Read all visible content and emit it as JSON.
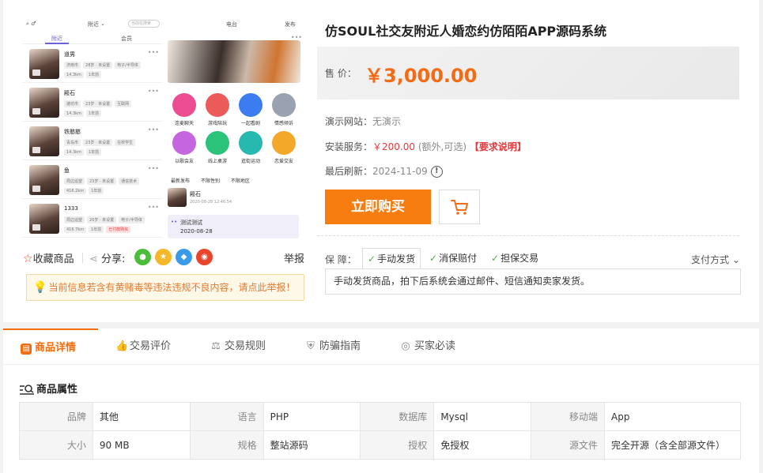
{
  "gallery": {
    "topbar": {
      "nearby_dropdown": "附近",
      "search_placeholder": "当前在搜索",
      "center": "电台",
      "publish": "发布"
    },
    "tabs": [
      "附近",
      "会员"
    ],
    "users": [
      {
        "name": "道男",
        "tags": [
          "济南市",
          "28岁 · 未设置",
          "电子/半导体"
        ],
        "meta": [
          "14.3km",
          "1年前"
        ]
      },
      {
        "name": "殿石",
        "tags": [
          "潍坊市",
          "23岁 · 未设置",
          "互联网"
        ],
        "meta": [
          "14.3km",
          "1年前"
        ]
      },
      {
        "name": "铁憨憨",
        "tags": [
          "青岛市",
          "23岁 · 未设置",
          "在校学生"
        ],
        "meta": [
          "14.3km",
          "1年前"
        ]
      },
      {
        "name": "鱼",
        "tags": [
          "周边遥望",
          "23岁 · 未设置",
          "通信技术"
        ],
        "meta": [
          "416.2km",
          "1年前"
        ]
      },
      {
        "name": "1333",
        "tags": [
          "周边遥望",
          "20岁 · 未设置",
          "电子/半导体"
        ],
        "meta": [
          "416.7km",
          "1年前",
          "已付款购买"
        ]
      }
    ],
    "icons": [
      {
        "label": "连麦聊天",
        "color": "#ec4c90"
      },
      {
        "label": "游戏陪玩",
        "color": "#ec5a5a"
      },
      {
        "label": "一起看剧",
        "color": "#3c7cf0"
      },
      {
        "label": "情感倾诉",
        "color": "#9aa1b0"
      },
      {
        "label": "以歌会友",
        "color": "#c565e0"
      },
      {
        "label": "线上桌游",
        "color": "#2bc27a"
      },
      {
        "label": "逛街运动",
        "color": "#27b8b0"
      },
      {
        "label": "恋爱交友",
        "color": "#f3a82a"
      }
    ],
    "filters": [
      "最新发布",
      "不限性别",
      "不限地区"
    ],
    "post": {
      "name": "殿石",
      "date": "2020-08-28 12:46:54"
    },
    "box": {
      "line1": "测试测试",
      "line2": "2020-08-28"
    }
  },
  "share": {
    "favorite_label": "收藏商品",
    "share_label": "分享:",
    "report_label": "举报",
    "icons": [
      {
        "name": "wechat-icon",
        "color": "#4cbd3a",
        "glyph": "●"
      },
      {
        "name": "qzone-icon",
        "color": "#f5b82a",
        "glyph": "★"
      },
      {
        "name": "qq-icon",
        "color": "#3b9be8",
        "glyph": "◆"
      },
      {
        "name": "weibo-icon",
        "color": "#e8452c",
        "glyph": "◉"
      }
    ]
  },
  "notice": "当前信息若含有黄赌毒等违法违规不良内容，请点此举报！",
  "product": {
    "title": "仿SOUL社交友附近人婚恋约仿陌陌APP源码系统",
    "price_label": "售 价：",
    "price": "￥3,000.00",
    "demo_label": "演示网站：",
    "demo_value": "无演示",
    "install_label": "安装服务：",
    "install_price": "￥200.00",
    "install_note": "(额外,可选)",
    "install_link": "【要求说明】",
    "refresh_label": "最后刷新：",
    "refresh_date": "2024-11-09",
    "buy_label": "立即购买"
  },
  "guarantee": {
    "label": "保 障：",
    "items": [
      "手动发货",
      "消保赔付",
      "担保交易"
    ],
    "pay_label": "支付方式",
    "desc": "手动发货商品，拍下后系统会通过邮件、短信通知卖家发货。"
  },
  "tabs": [
    "商品详情",
    "交易评价",
    "交易规则",
    "防骗指南",
    "买家必读"
  ],
  "attributes": {
    "title": "商品属性",
    "rows": [
      [
        {
          "k": "品牌",
          "v": "其他"
        },
        {
          "k": "语言",
          "v": "PHP"
        },
        {
          "k": "数据库",
          "v": "Mysql"
        },
        {
          "k": "移动端",
          "v": "App"
        }
      ],
      [
        {
          "k": "大小",
          "v": "90 MB"
        },
        {
          "k": "规格",
          "v": "整站源码"
        },
        {
          "k": "授权",
          "v": "免授权"
        },
        {
          "k": "源文件",
          "v": "完全开源（含全部源文件）"
        }
      ]
    ]
  },
  "colors": {
    "accent": "#f77d10",
    "price": "#f56a13",
    "red": "#e4393c",
    "purple": "#6c63d9"
  }
}
